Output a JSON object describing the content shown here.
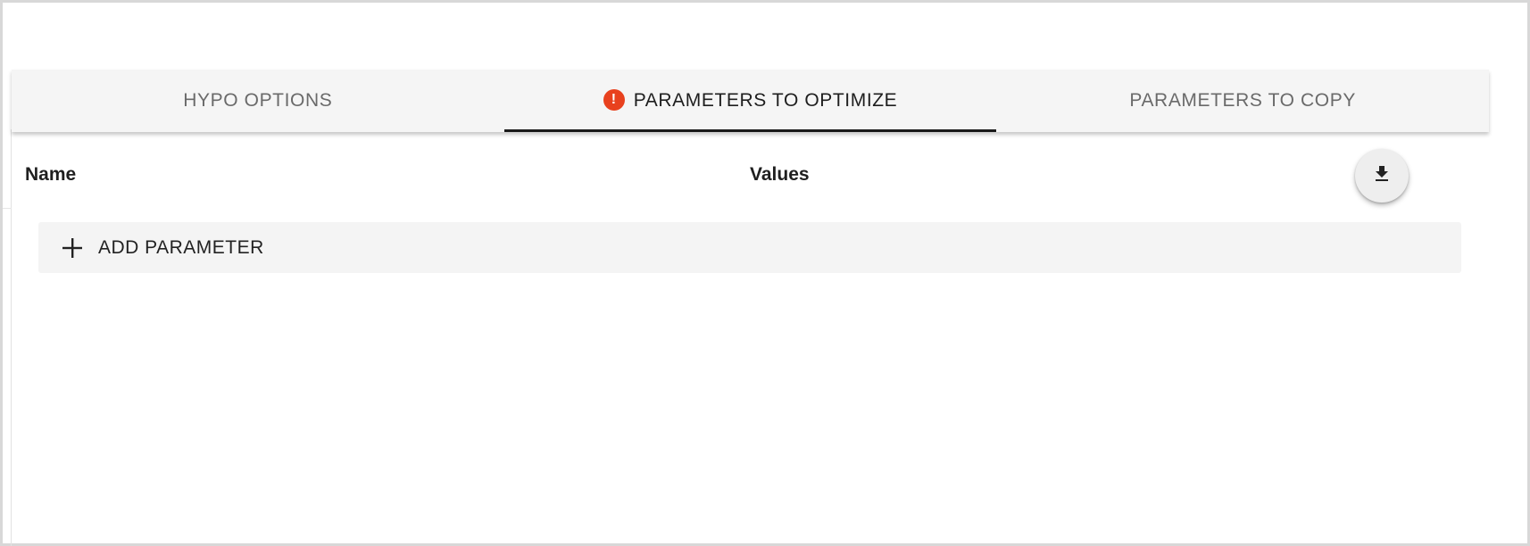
{
  "tabs": [
    {
      "label": "HYPO OPTIONS",
      "active": false,
      "error": false
    },
    {
      "label": "PARAMETERS TO OPTIMIZE",
      "active": true,
      "error": true
    },
    {
      "label": "PARAMETERS TO COPY",
      "active": false,
      "error": false
    }
  ],
  "error_icon": {
    "glyph": "!",
    "color": "#e8411e"
  },
  "table": {
    "columns": [
      "Name",
      "Values"
    ]
  },
  "actions": {
    "download_icon": "download-icon",
    "add_parameter_label": "ADD PARAMETER",
    "add_icon": "plus-icon"
  }
}
